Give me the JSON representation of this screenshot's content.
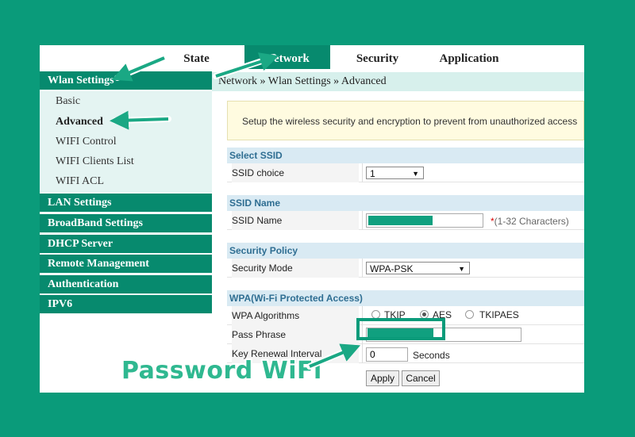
{
  "topnav": {
    "tabs": [
      {
        "label": "State",
        "active": false
      },
      {
        "label": "Network",
        "active": true
      },
      {
        "label": "Security",
        "active": false
      },
      {
        "label": "Application",
        "active": false
      }
    ]
  },
  "sidebar": {
    "sections": [
      "Wlan Settings",
      "LAN Settings",
      "BroadBand Settings",
      "DHCP Server",
      "Remote Management",
      "Authentication",
      "IPV6"
    ],
    "submenu": [
      "Basic",
      "Advanced",
      "WIFI Control",
      "WIFI Clients List",
      "WIFI ACL"
    ],
    "active_item": "Advanced"
  },
  "breadcrumb": "Network » Wlan Settings » Advanced",
  "notice": "Setup the wireless security and encryption to prevent from unauthorized access",
  "select_ssid": {
    "heading": "Select SSID",
    "label": "SSID choice",
    "value": "1"
  },
  "ssid_name": {
    "heading": "SSID Name",
    "label": "SSID Name",
    "hint_star": "*",
    "hint": "(1-32 Characters)"
  },
  "security_policy": {
    "heading": "Security Policy",
    "label": "Security Mode",
    "value": "WPA-PSK"
  },
  "wpa": {
    "heading": "WPA(Wi-Fi Protected Access)",
    "algorithms_label": "WPA Algorithms",
    "algorithms": [
      {
        "label": "TKIP",
        "checked": false
      },
      {
        "label": "AES",
        "checked": true
      },
      {
        "label": "TKIPAES",
        "checked": false
      }
    ],
    "pass_phrase_label": "Pass Phrase",
    "key_renewal_label": "Key Renewal Interval",
    "key_renewal_value": "0",
    "key_renewal_unit": "Seconds"
  },
  "buttons": {
    "apply": "Apply",
    "cancel": "Cancel"
  },
  "overlay": {
    "label": "Password WiFi"
  },
  "colors": {
    "accent": "#078a6e",
    "background": "#0a9b7a",
    "mask": "#10a07f"
  }
}
